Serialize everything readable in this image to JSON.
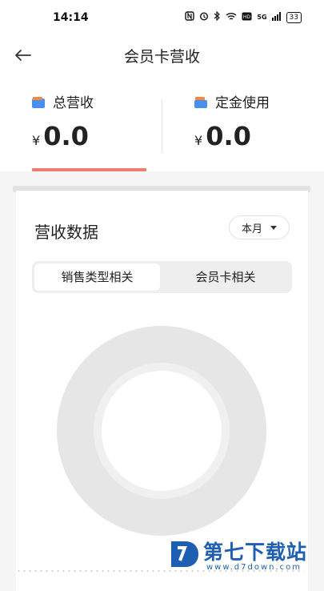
{
  "status_bar": {
    "time": "14:14",
    "icons": [
      "nfc-icon",
      "alarm-icon",
      "bluetooth-icon",
      "wifi-icon",
      "hd-icon",
      "signal-icon"
    ],
    "network_label": "5G",
    "battery_level": "33"
  },
  "nav": {
    "title": "会员卡营收",
    "back_icon": "arrow-left-icon"
  },
  "summary": {
    "total_label": "总营收",
    "total_currency": "¥",
    "total_value": "0.0",
    "deposit_label": "定金使用",
    "deposit_currency": "¥",
    "deposit_value": "0.0",
    "active_underline_color": "#ee7c72"
  },
  "card": {
    "title": "营收数据",
    "period_select": "本月",
    "tabs": [
      {
        "label": "销售类型相关",
        "active": true
      },
      {
        "label": "会员卡相关",
        "active": false
      }
    ]
  },
  "chart_data": {
    "type": "pie",
    "style": "donut",
    "values": [],
    "color_empty": "#e6e6e6"
  },
  "watermark": {
    "title": "第七下载站",
    "url": "www.d7down.com",
    "color": "#1f5fb3"
  }
}
